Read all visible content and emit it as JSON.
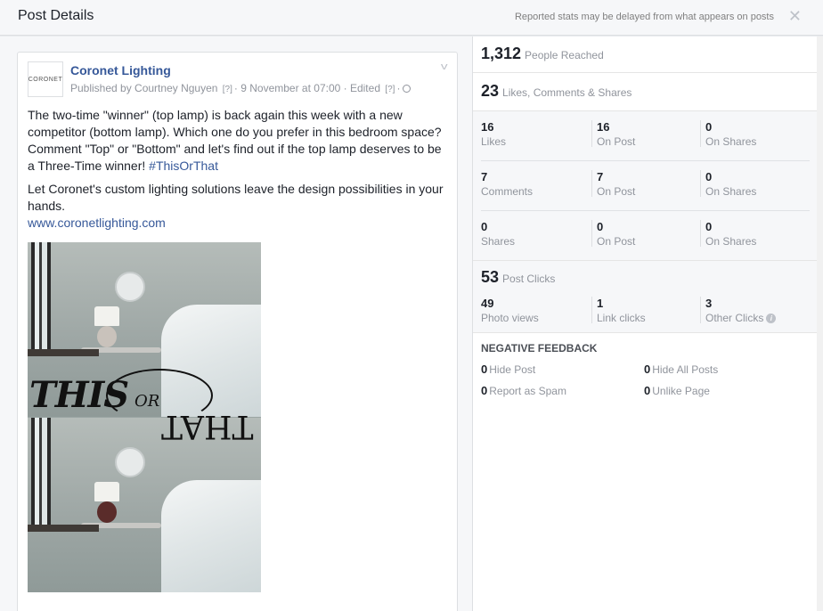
{
  "header": {
    "title": "Post Details",
    "note": "Reported stats may be delayed from what appears on posts",
    "close_glyph": "✕"
  },
  "post": {
    "logo_text": "CORONET",
    "page_name": "Coronet Lighting",
    "published_by": "Published by Courtney Nguyen",
    "help1": "[?]",
    "date": "· 9 November at 07:00 · Edited",
    "help2": "[?]",
    "dot": "·",
    "text1": "The two-time \"winner\" (top lamp) is back again this week with a new competitor (bottom lamp). Which one do you prefer in this bedroom space? Comment \"Top\" or \"Bottom\" and let's find out if the top lamp deserves to be a Three-Time winner!",
    "hashtag": "#ThisOrThat",
    "text2": "Let Coronet's custom lighting solutions leave the design possibilities in your hands.",
    "link": "www.coronetlighting.com",
    "image_text": {
      "this": "THIS",
      "or": "OR",
      "that": "THAT"
    }
  },
  "stats": {
    "reached": {
      "value": "1,312",
      "label": "People Reached"
    },
    "engagement": {
      "value": "23",
      "label": "Likes, Comments & Shares"
    },
    "grid": [
      [
        {
          "n": "16",
          "l": "Likes"
        },
        {
          "n": "16",
          "l": "On Post"
        },
        {
          "n": "0",
          "l": "On Shares"
        }
      ],
      [
        {
          "n": "7",
          "l": "Comments"
        },
        {
          "n": "7",
          "l": "On Post"
        },
        {
          "n": "0",
          "l": "On Shares"
        }
      ],
      [
        {
          "n": "0",
          "l": "Shares"
        },
        {
          "n": "0",
          "l": "On Post"
        },
        {
          "n": "0",
          "l": "On Shares"
        }
      ]
    ],
    "post_clicks": {
      "value": "53",
      "label": "Post Clicks",
      "items": [
        {
          "n": "49",
          "l": "Photo views"
        },
        {
          "n": "1",
          "l": "Link clicks"
        },
        {
          "n": "3",
          "l": "Other Clicks"
        }
      ],
      "info_glyph": "i"
    },
    "negative": {
      "title": "NEGATIVE FEEDBACK",
      "items": [
        {
          "n": "0",
          "l": "Hide Post"
        },
        {
          "n": "0",
          "l": "Hide All Posts"
        },
        {
          "n": "0",
          "l": "Report as Spam"
        },
        {
          "n": "0",
          "l": "Unlike Page"
        }
      ]
    }
  }
}
